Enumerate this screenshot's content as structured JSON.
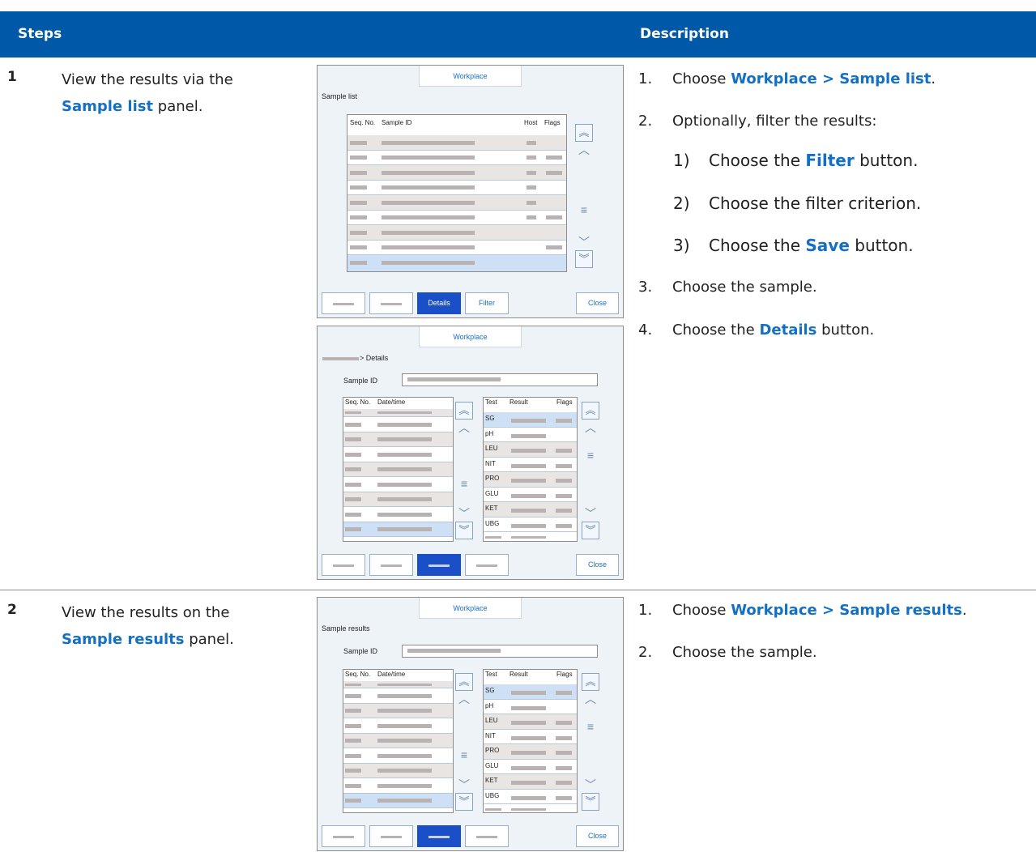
{
  "header": {
    "steps": "Steps",
    "description": "Description"
  },
  "step1": {
    "number": "1",
    "text_before": "View the results via the",
    "panel_name": "Sample list",
    "text_after": " panel.",
    "instructions": [
      {
        "n": "1.",
        "before": "Choose ",
        "bold": "Workplace > Sample list",
        "after": "."
      },
      {
        "n": "2.",
        "before": "Optionally, filter the results:",
        "bold": "",
        "after": ""
      },
      {
        "n": "1)",
        "before": "Choose the ",
        "bold": "Filter",
        "after": " button."
      },
      {
        "n": "2)",
        "before": "Choose the filter criterion.",
        "bold": "",
        "after": ""
      },
      {
        "n": "3)",
        "before": "Choose the ",
        "bold": "Save",
        "after": " button."
      },
      {
        "n": "3.",
        "before": "Choose the sample.",
        "bold": "",
        "after": ""
      },
      {
        "n": "4.",
        "before": "Choose the ",
        "bold": "Details",
        "after": " button."
      }
    ]
  },
  "step2": {
    "number": "2",
    "text_before": "View the results on the",
    "panel_name": "Sample results",
    "text_after": " panel.",
    "instructions": [
      {
        "n": "1.",
        "before": "Choose ",
        "bold": "Workplace > Sample results",
        "after": "."
      },
      {
        "n": "2.",
        "before": "Choose the sample.",
        "bold": "",
        "after": ""
      }
    ]
  },
  "screen_list": {
    "tab": "Workplace",
    "title": "Sample list",
    "columns": [
      "Seq. No.",
      "Sample ID",
      "Host",
      "Flags"
    ],
    "buttons": {
      "details": "Details",
      "filter": "Filter",
      "close": "Close"
    }
  },
  "screen_details": {
    "tab": "Workplace",
    "breadcrumb": "> Details",
    "sample_id_label": "Sample ID",
    "left_columns": [
      "Seq. No.",
      "Date/time"
    ],
    "right_columns": [
      "Test",
      "Result",
      "Flags"
    ],
    "tests": [
      "SG",
      "pH",
      "LEU",
      "NIT",
      "PRO",
      "GLU",
      "KET",
      "UBG"
    ],
    "buttons": {
      "close": "Close"
    }
  },
  "screen_results": {
    "tab": "Workplace",
    "title": "Sample results",
    "sample_id_label": "Sample ID",
    "left_columns": [
      "Seq. No.",
      "Date/time"
    ],
    "right_columns": [
      "Test",
      "Result",
      "Flags"
    ],
    "tests": [
      "SG",
      "pH",
      "LEU",
      "NIT",
      "PRO",
      "GLU",
      "KET",
      "UBG"
    ],
    "buttons": {
      "close": "Close"
    }
  },
  "colors": {
    "header": "#0058a8",
    "highlight": "#1470c4",
    "primary_button": "#1a4fc8"
  },
  "icons": [
    "page-up-icon",
    "chevron-up-icon",
    "scroll-handle-icon",
    "chevron-down-icon",
    "page-down-icon"
  ]
}
